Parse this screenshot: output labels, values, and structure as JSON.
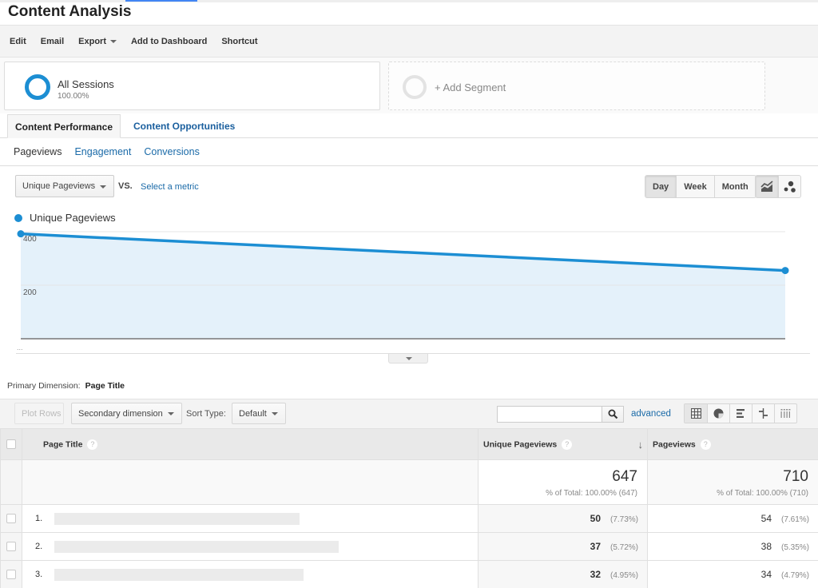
{
  "page": {
    "title": "Content Analysis"
  },
  "toolbar": {
    "items": [
      {
        "label": "Edit"
      },
      {
        "label": "Email"
      },
      {
        "label": "Export",
        "has_dropdown": true
      },
      {
        "label": "Add to Dashboard"
      },
      {
        "label": "Shortcut"
      }
    ]
  },
  "segments": {
    "active": {
      "name": "All Sessions",
      "percent": "100.00%",
      "color": "#1c8ed3"
    },
    "add_label": "+ Add Segment"
  },
  "tabs": [
    {
      "label": "Content Performance",
      "active": true
    },
    {
      "label": "Content Opportunities",
      "active": false
    }
  ],
  "subtabs": [
    {
      "label": "Pageviews",
      "active": true
    },
    {
      "label": "Engagement",
      "active": false
    },
    {
      "label": "Conversions",
      "active": false
    }
  ],
  "chart_controls": {
    "metric": "Unique Pageviews",
    "vs_label": "VS.",
    "compare_link": "Select a metric",
    "periods": [
      {
        "label": "Day",
        "selected": true
      },
      {
        "label": "Week",
        "selected": false
      },
      {
        "label": "Month",
        "selected": false
      }
    ],
    "views": [
      {
        "icon": "line-chart-icon",
        "selected": true
      },
      {
        "icon": "motion-chart-icon",
        "selected": false
      }
    ]
  },
  "chart_data": {
    "type": "area",
    "title": "",
    "legend": [
      {
        "name": "Unique Pageviews",
        "color": "#1c8ed3"
      }
    ],
    "legend_position": "top-left",
    "x": [
      "",
      ""
    ],
    "x_tick_labels": [
      "..."
    ],
    "series": [
      {
        "name": "Unique Pageviews",
        "values": [
          392,
          255
        ],
        "color": "#1c8ed3",
        "fill": "#e4f1fa"
      }
    ],
    "y_ticks": [
      200,
      400
    ],
    "y_tick_labels": [
      "200",
      "400"
    ],
    "ylim": [
      0,
      400
    ],
    "grid": true,
    "xlabel": "",
    "ylabel": ""
  },
  "table_controls": {
    "primary_dimension_label": "Primary Dimension:",
    "primary_dimension_value": "Page Title",
    "plot_rows": "Plot Rows",
    "secondary_dimension": "Secondary dimension",
    "sort_type_label": "Sort Type:",
    "sort_type_value": "Default",
    "search_value": "",
    "search_placeholder": "",
    "advanced_link": "advanced",
    "viz_buttons": [
      "table-icon",
      "pie-chart-icon",
      "bar-chart-icon",
      "comparison-icon",
      "pivot-icon"
    ]
  },
  "table": {
    "columns": [
      {
        "label": "Page Title",
        "help": "?"
      },
      {
        "label": "Unique Pageviews",
        "help": "?",
        "sorted": "desc"
      },
      {
        "label": "Pageviews",
        "help": "?"
      }
    ],
    "totals": {
      "unique_pageviews": "647",
      "unique_pageviews_sub": "% of Total: 100.00% (647)",
      "pageviews": "710",
      "pageviews_sub": "% of Total: 100.00% (710)"
    },
    "rows": [
      {
        "rank": "1.",
        "title": "",
        "unique_pageviews": "50",
        "unique_pct": "(7.73%)",
        "pageviews": "54",
        "pageviews_pct": "(7.61%)"
      },
      {
        "rank": "2.",
        "title": "",
        "unique_pageviews": "37",
        "unique_pct": "(5.72%)",
        "pageviews": "38",
        "pageviews_pct": "(5.35%)"
      },
      {
        "rank": "3.",
        "title": "",
        "unique_pageviews": "32",
        "unique_pct": "(4.95%)",
        "pageviews": "34",
        "pageviews_pct": "(4.79%)"
      }
    ]
  }
}
